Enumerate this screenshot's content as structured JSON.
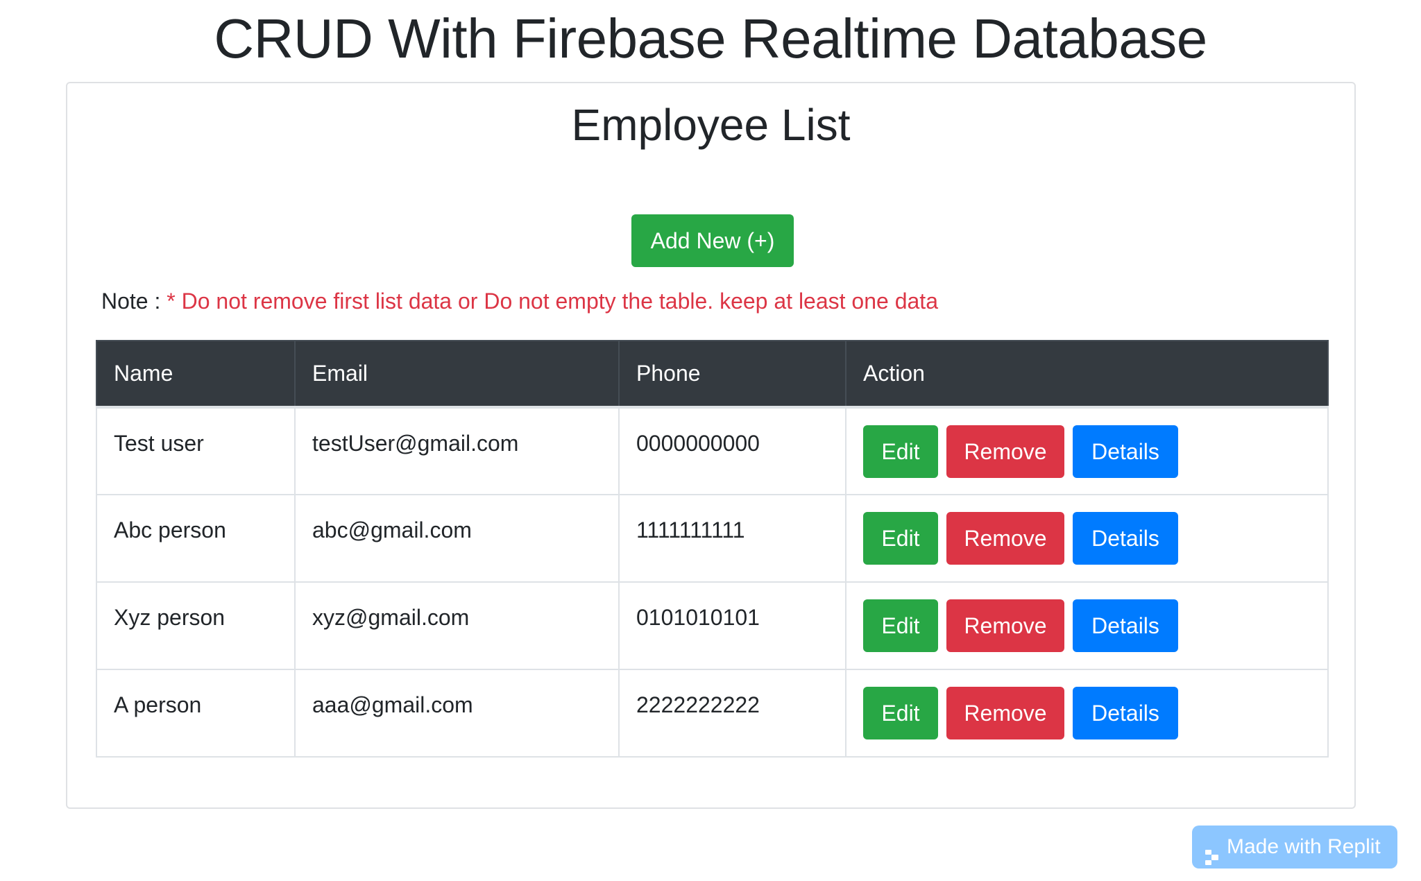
{
  "page": {
    "title": "CRUD With Firebase Realtime Database"
  },
  "card": {
    "title": "Employee List",
    "add_button_label": "Add New (+)",
    "note_label": "Note :",
    "note_text": "* Do not remove first list data or Do not empty the table. keep at least one data"
  },
  "table": {
    "columns": [
      "Name",
      "Email",
      "Phone",
      "Action"
    ],
    "rows": [
      {
        "name": "Test user",
        "email": "testUser@gmail.com",
        "phone": "0000000000"
      },
      {
        "name": "Abc person",
        "email": "abc@gmail.com",
        "phone": "1111111111"
      },
      {
        "name": "Xyz person",
        "email": "xyz@gmail.com",
        "phone": "0101010101"
      },
      {
        "name": "A person",
        "email": "aaa@gmail.com",
        "phone": "2222222222"
      }
    ],
    "actions": {
      "edit_label": "Edit",
      "remove_label": "Remove",
      "details_label": "Details"
    }
  },
  "badge": {
    "label": "Made with Replit",
    "icon": "replit-icon"
  },
  "colors": {
    "success": "#28a745",
    "danger": "#dc3545",
    "primary": "#007bff",
    "table_header": "#343a40",
    "badge": "#8cc6ff"
  }
}
